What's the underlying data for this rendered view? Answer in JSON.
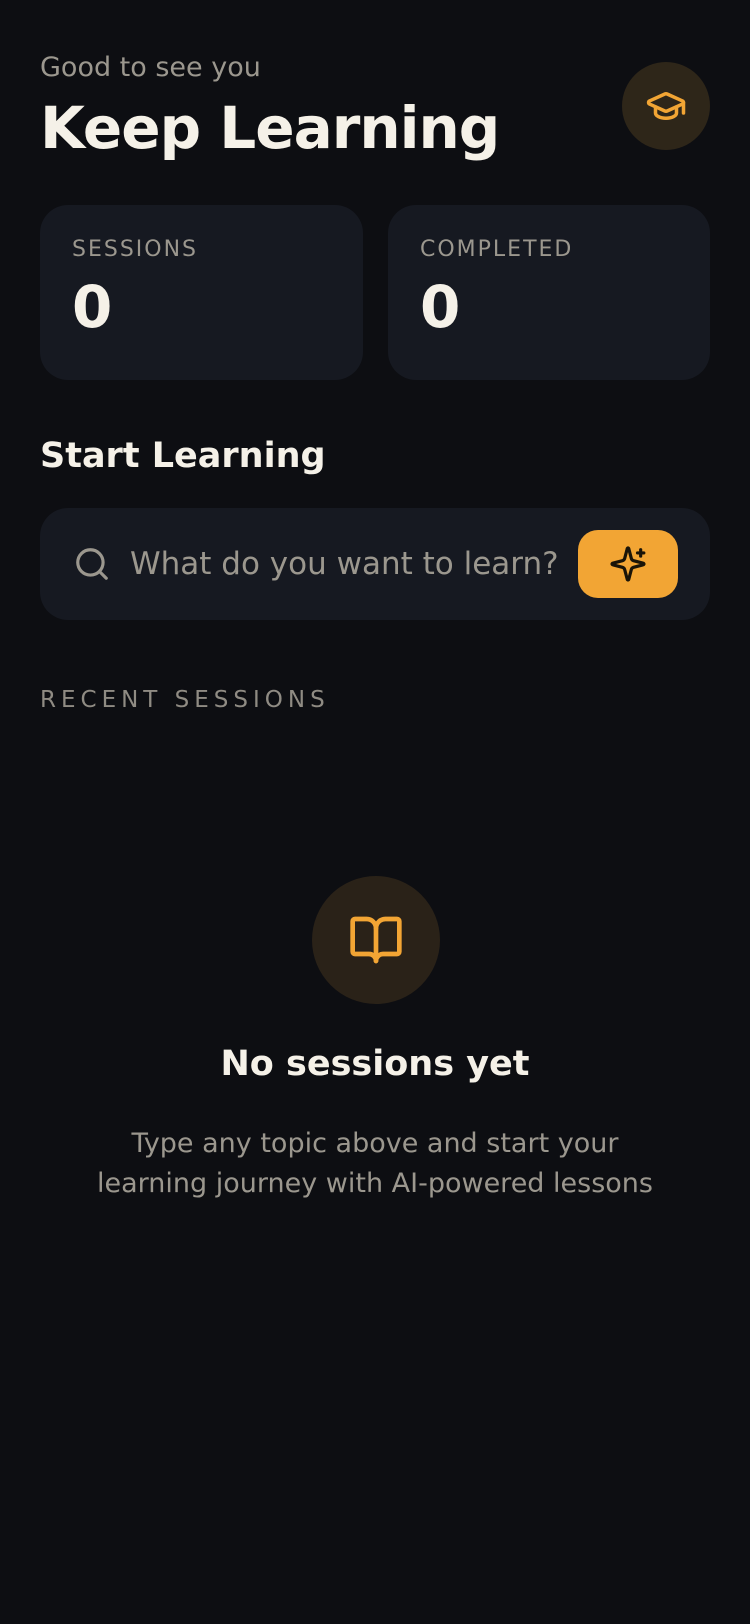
{
  "header": {
    "greeting": "Good to see you",
    "title": "Keep Learning",
    "avatar_icon": "graduation-cap-icon"
  },
  "stats": [
    {
      "label": "SESSIONS",
      "value": "0"
    },
    {
      "label": "COMPLETED",
      "value": "0"
    }
  ],
  "start": {
    "title": "Start Learning",
    "search_icon": "search-icon",
    "placeholder": "What do you want to learn?",
    "value": "",
    "button_icon": "sparkles-icon"
  },
  "recent": {
    "label": "RECENT SESSIONS"
  },
  "empty": {
    "icon": "book-open-icon",
    "title": "No sessions yet",
    "line1": "Type any topic above and start your",
    "line2": "learning journey with AI-powered lessons"
  },
  "colors": {
    "background": "#0d0e12",
    "card": "#161921",
    "accent": "#f2a534",
    "text_primary": "#f5f1e8",
    "text_muted": "#9b978e"
  }
}
